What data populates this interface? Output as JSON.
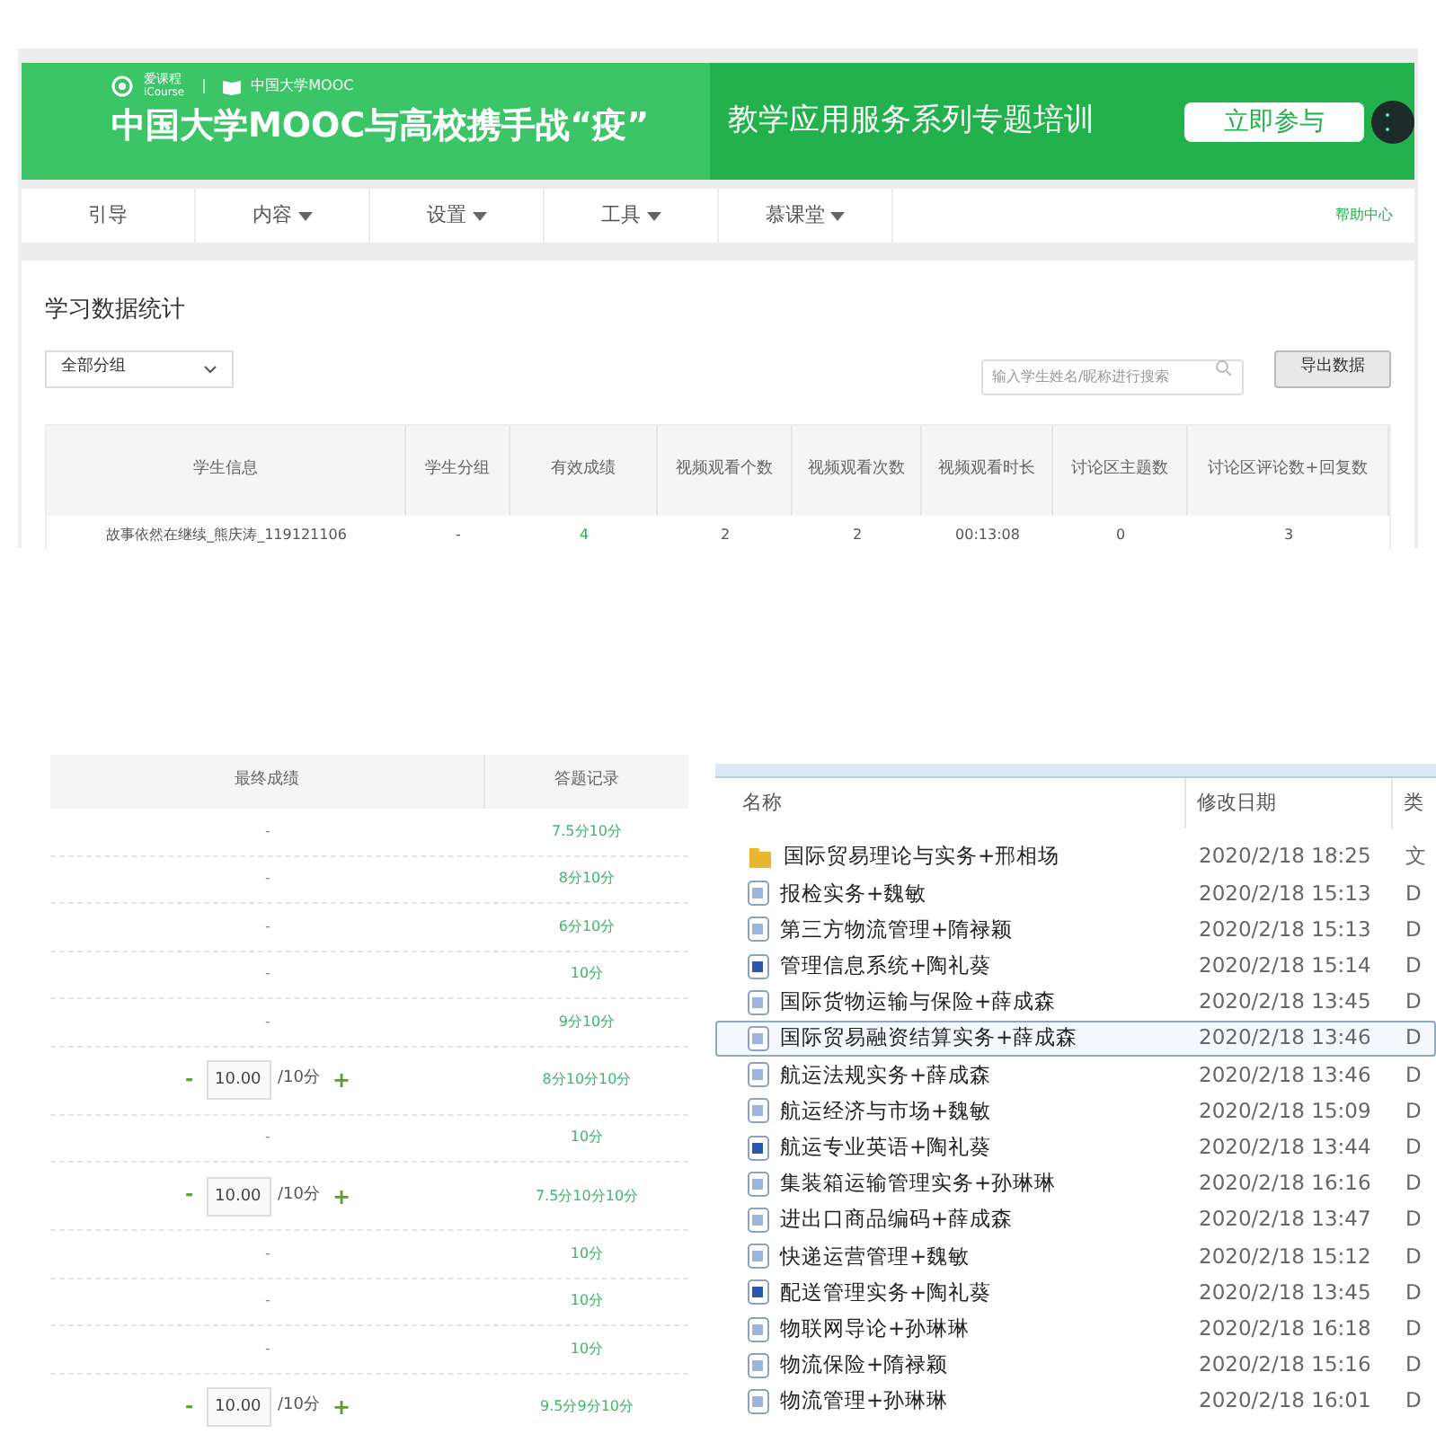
{
  "mooc_page": {
    "banner": {
      "logo_main": "爱课程",
      "logo_sub": "iCourse",
      "partner_logo": "中国大学MOOC",
      "headline": "中国大学MOOC与高校携手战“疫”",
      "subtitle": "教学应用服务系列专题培训",
      "cta": "立即参与"
    },
    "nav": {
      "items": [
        {
          "label": "引导",
          "has_menu": false
        },
        {
          "label": "内容",
          "has_menu": true
        },
        {
          "label": "设置",
          "has_menu": true
        },
        {
          "label": "工具",
          "has_menu": true
        },
        {
          "label": "慕课堂",
          "has_menu": true
        }
      ],
      "help": "帮助中心"
    },
    "title": "学习数据统计",
    "group_select": "全部分组",
    "search": {
      "placeholder": "输入学生姓名/昵称进行搜索"
    },
    "export_button": "导出数据",
    "table": {
      "columns": [
        "学生信息",
        "学生分组",
        "有效成绩",
        "视频观看个数",
        "视频观看次数",
        "视频观看时长",
        "讨论区主题数",
        "讨论区评论数+回复数"
      ],
      "rows": [
        [
          "故事依然在继续_熊庆涛_119121106",
          "-",
          "4",
          "2",
          "2",
          "00:13:08",
          "0",
          "3"
        ]
      ]
    }
  },
  "grade_table": {
    "columns": [
      "最终成绩",
      "答题记录"
    ],
    "rows": [
      {
        "kind": "plain",
        "final": "-",
        "record": "7.5分10分"
      },
      {
        "kind": "plain",
        "final": "-",
        "record": "8分10分"
      },
      {
        "kind": "plain",
        "final": "-",
        "record": "6分10分"
      },
      {
        "kind": "plain",
        "final": "-",
        "record": "10分"
      },
      {
        "kind": "plain",
        "final": "-",
        "record": "9分10分"
      },
      {
        "kind": "editable",
        "minus": "-",
        "value": "10.00",
        "max": "/10分",
        "plus": "+",
        "record": "8分10分10分"
      },
      {
        "kind": "plain",
        "final": "-",
        "record": "10分"
      },
      {
        "kind": "editable",
        "minus": "-",
        "value": "10.00",
        "max": "/10分",
        "plus": "+",
        "record": "7.5分10分10分"
      },
      {
        "kind": "plain",
        "final": "-",
        "record": "10分"
      },
      {
        "kind": "plain",
        "final": "-",
        "record": "10分"
      },
      {
        "kind": "plain",
        "final": "-",
        "record": "10分"
      },
      {
        "kind": "editable",
        "minus": "-",
        "value": "10.00",
        "max": "/10分",
        "plus": "+",
        "record": "9.5分9分10分"
      }
    ]
  },
  "file_list": {
    "columns": [
      "名称",
      "修改日期",
      "类"
    ],
    "files": [
      {
        "kind": "folder",
        "name": "国际贸易理论与实务+邢相场",
        "date": "2020/2/18 18:25",
        "type": "文",
        "selected": false
      },
      {
        "kind": "doc",
        "name": "报检实务+魏敏",
        "date": "2020/2/18 15:13",
        "type": "D",
        "selected": false
      },
      {
        "kind": "doc",
        "name": "第三方物流管理+隋禄颖",
        "date": "2020/2/18 15:13",
        "type": "D",
        "selected": false
      },
      {
        "kind": "docx",
        "name": "管理信息系统+陶礼葵",
        "date": "2020/2/18 15:14",
        "type": "D",
        "selected": false
      },
      {
        "kind": "doc",
        "name": "国际货物运输与保险+薛成森",
        "date": "2020/2/18 13:45",
        "type": "D",
        "selected": false
      },
      {
        "kind": "doc",
        "name": "国际贸易融资结算实务+薛成森",
        "date": "2020/2/18 13:46",
        "type": "D",
        "selected": true
      },
      {
        "kind": "doc",
        "name": "航运法规实务+薛成森",
        "date": "2020/2/18 13:46",
        "type": "D",
        "selected": false
      },
      {
        "kind": "doc",
        "name": "航运经济与市场+魏敏",
        "date": "2020/2/18 15:09",
        "type": "D",
        "selected": false
      },
      {
        "kind": "docx",
        "name": "航运专业英语+陶礼葵",
        "date": "2020/2/18 13:44",
        "type": "D",
        "selected": false
      },
      {
        "kind": "doc",
        "name": "集装箱运输管理实务+孙琳琳",
        "date": "2020/2/18 16:16",
        "type": "D",
        "selected": false
      },
      {
        "kind": "doc",
        "name": "进出口商品编码+薛成森",
        "date": "2020/2/18 13:47",
        "type": "D",
        "selected": false
      },
      {
        "kind": "doc",
        "name": "快递运营管理+魏敏",
        "date": "2020/2/18 15:12",
        "type": "D",
        "selected": false
      },
      {
        "kind": "docx",
        "name": "配送管理实务+陶礼葵",
        "date": "2020/2/18 13:45",
        "type": "D",
        "selected": false
      },
      {
        "kind": "doc",
        "name": "物联网导论+孙琳琳",
        "date": "2020/2/18 16:18",
        "type": "D",
        "selected": false
      },
      {
        "kind": "doc",
        "name": "物流保险+隋禄颖",
        "date": "2020/2/18 15:16",
        "type": "D",
        "selected": false
      },
      {
        "kind": "doc",
        "name": "物流管理+孙琳琳",
        "date": "2020/2/18 16:01",
        "type": "D",
        "selected": false
      }
    ]
  }
}
